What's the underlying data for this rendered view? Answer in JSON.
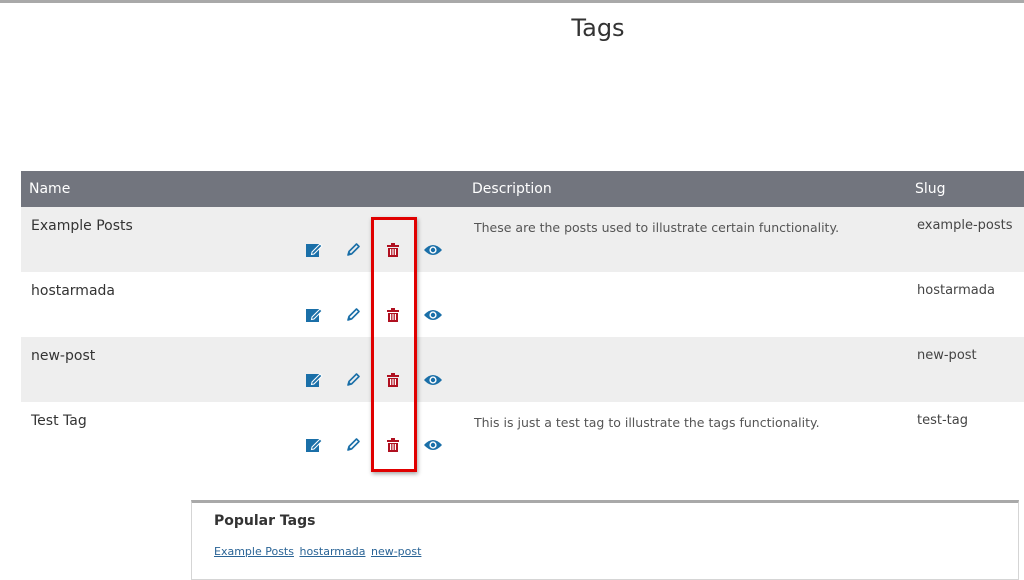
{
  "page": {
    "title": "Tags"
  },
  "table": {
    "headers": {
      "name": "Name",
      "description": "Description",
      "slug": "Slug"
    },
    "rows": [
      {
        "name": "Example Posts",
        "description": "These are the posts used to illustrate certain functionality.",
        "slug": "example-posts"
      },
      {
        "name": "hostarmada",
        "description": "",
        "slug": "hostarmada"
      },
      {
        "name": "new-post",
        "description": "",
        "slug": "new-post"
      },
      {
        "name": "Test Tag",
        "description": "This is just a test tag to illustrate the tags functionality.",
        "slug": "test-tag"
      }
    ],
    "actions": {
      "edit_icon": "edit-icon",
      "quick_edit_icon": "pencil-icon",
      "delete_icon": "trash-icon",
      "view_icon": "eye-icon"
    }
  },
  "popular_tags": {
    "title": "Popular Tags",
    "links": [
      "Example Posts",
      "hostarmada",
      "new-post"
    ]
  },
  "colors": {
    "header_bg": "#72757e",
    "row_alt_bg": "#eeeeee",
    "action_blue": "#1a6fa8",
    "delete_red": "#b01020",
    "highlight_red": "#e00000",
    "link_blue": "#2a6496"
  }
}
